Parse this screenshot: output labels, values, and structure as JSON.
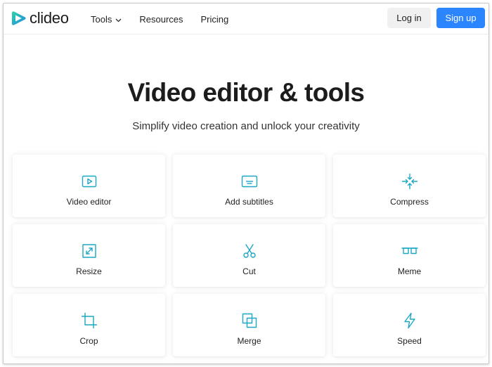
{
  "brand": {
    "name": "clideo",
    "accent": "#1ca7c4",
    "primary_button_color": "#2b85ff"
  },
  "nav": {
    "items": [
      {
        "label": "Tools",
        "has_dropdown": true
      },
      {
        "label": "Resources"
      },
      {
        "label": "Pricing"
      }
    ]
  },
  "auth": {
    "login_label": "Log in",
    "signup_label": "Sign up"
  },
  "hero": {
    "title": "Video editor & tools",
    "subtitle": "Simplify video creation and unlock your creativity"
  },
  "tools": [
    {
      "label": "Video editor",
      "icon": "video-play-icon"
    },
    {
      "label": "Add subtitles",
      "icon": "subtitles-icon"
    },
    {
      "label": "Compress",
      "icon": "compress-icon"
    },
    {
      "label": "Resize",
      "icon": "resize-icon"
    },
    {
      "label": "Cut",
      "icon": "scissors-icon"
    },
    {
      "label": "Meme",
      "icon": "glasses-icon"
    },
    {
      "label": "Crop",
      "icon": "crop-icon"
    },
    {
      "label": "Merge",
      "icon": "merge-icon"
    },
    {
      "label": "Speed",
      "icon": "lightning-icon"
    }
  ]
}
